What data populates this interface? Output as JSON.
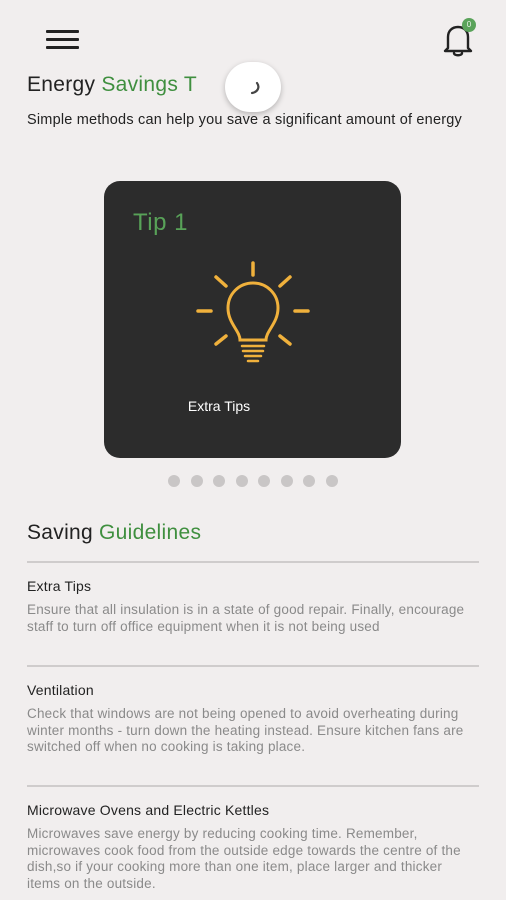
{
  "header": {
    "menu_icon": "hamburger-menu-icon",
    "bell_icon": "bell-icon",
    "notification_count": "0"
  },
  "energy_section": {
    "title": "Energy",
    "title_accent": "Savings T",
    "subtitle": "Simple methods can help you save a significant amount of energy"
  },
  "tip_card": {
    "title": "Tip 1",
    "icon": "lightbulb-icon",
    "caption": "Extra Tips",
    "card_color": "#2c2c2c",
    "accent_color": "#58a258",
    "bulb_color": "#f0b13c"
  },
  "pagination": {
    "total": 8,
    "active_index": 0
  },
  "guidelines_section": {
    "title": "Saving",
    "title_accent": "Guidelines",
    "items": [
      {
        "title": "Extra Tips",
        "body": "Ensure that all insulation is in a state of good repair. Finally, encourage staff to turn off office equipment when it is not being used"
      },
      {
        "title": "Ventilation",
        "body": "Check that windows are not being opened to avoid overheating during winter months - turn down the heating instead. Ensure kitchen fans are switched off when no cooking is taking place."
      },
      {
        "title": "Microwave Ovens and Electric Kettles",
        "body": "Microwaves save energy by reducing cooking time. Remember, microwaves cook food from the outside edge towards the centre of the dish,so if your cooking more than one item, place larger and thicker items on the outside."
      }
    ]
  },
  "colors": {
    "background": "#f1eeee",
    "accent_green": "#3f8f3f",
    "muted_text": "#8a8a8a"
  }
}
